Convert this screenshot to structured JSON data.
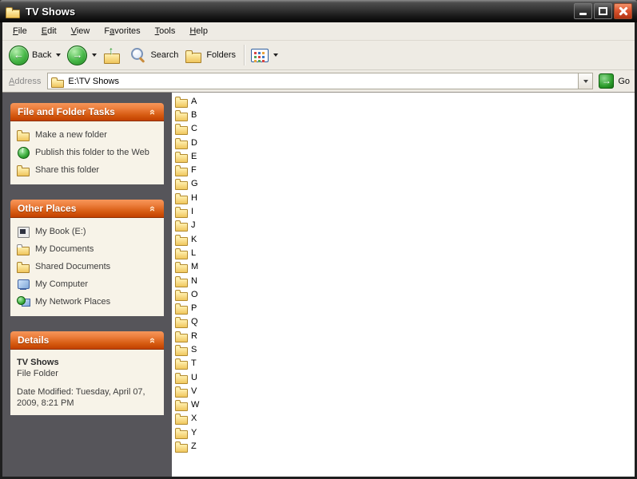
{
  "window": {
    "title": "TV Shows"
  },
  "menubar": {
    "items": [
      {
        "label": "File",
        "accel": 0
      },
      {
        "label": "Edit",
        "accel": 0
      },
      {
        "label": "View",
        "accel": 0
      },
      {
        "label": "Favorites",
        "accel": 1
      },
      {
        "label": "Tools",
        "accel": 0
      },
      {
        "label": "Help",
        "accel": 0
      }
    ]
  },
  "toolbar": {
    "back_label": "Back",
    "search_label": "Search",
    "folders_label": "Folders"
  },
  "address": {
    "label": "Address",
    "accel": 0,
    "value": "E:\\TV Shows",
    "go_label": "Go"
  },
  "sidebar": {
    "panels": [
      {
        "title": "File and Folder Tasks",
        "items": [
          {
            "icon": "new-folder-icon",
            "label": "Make a new folder"
          },
          {
            "icon": "publish-web-icon",
            "label": "Publish this folder to the Web"
          },
          {
            "icon": "share-folder-icon",
            "label": "Share this folder"
          }
        ]
      },
      {
        "title": "Other Places",
        "items": [
          {
            "icon": "drive-icon",
            "label": "My Book (E:)"
          },
          {
            "icon": "my-documents-icon",
            "label": "My Documents"
          },
          {
            "icon": "shared-documents-icon",
            "label": "Shared Documents"
          },
          {
            "icon": "my-computer-icon",
            "label": "My Computer"
          },
          {
            "icon": "network-icon",
            "label": "My Network Places"
          }
        ]
      },
      {
        "title": "Details",
        "lines": [
          {
            "text": "TV Shows",
            "bold": true,
            "spaced": false
          },
          {
            "text": "File Folder",
            "bold": false,
            "spaced": false
          },
          {
            "text": "Date Modified: Tuesday, April 07, 2009, 8:21 PM",
            "bold": false,
            "spaced": true
          }
        ]
      }
    ]
  },
  "folder_list": {
    "items": [
      "A",
      "B",
      "C",
      "D",
      "E",
      "F",
      "G",
      "H",
      "I",
      "J",
      "K",
      "L",
      "M",
      "N",
      "O",
      "P",
      "Q",
      "R",
      "S",
      "T",
      "U",
      "V",
      "W",
      "X",
      "Y",
      "Z"
    ]
  },
  "colors": {
    "panel_header_top": "#EE8140",
    "panel_header_bottom": "#C24100",
    "sidebar_bg": "#56555A",
    "panel_body_bg": "#F7F3E8",
    "close_button": "#DD5630",
    "nav_green": "#2E9E2E",
    "toolbar_bg": "#EEEBE4"
  }
}
